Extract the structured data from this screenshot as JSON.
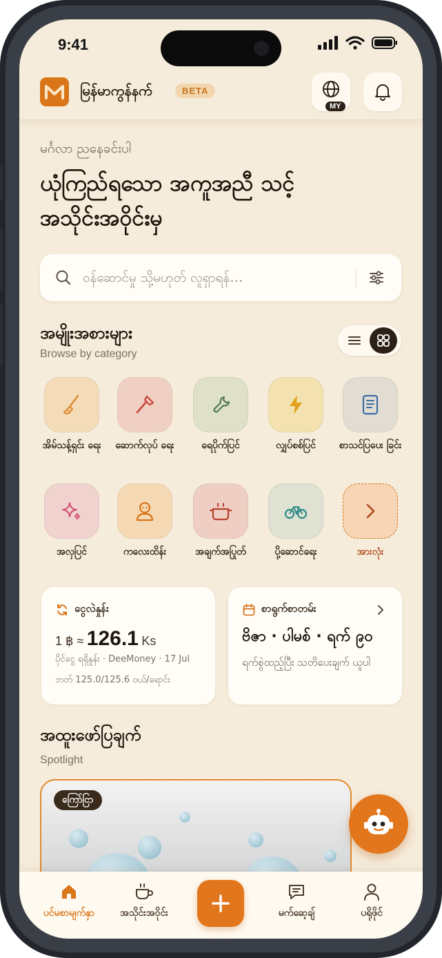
{
  "status_bar": {
    "time": "9:41"
  },
  "header": {
    "app_name": "မြန်မာကွန်နက်",
    "beta_badge": "BETA",
    "language_code": "MY",
    "icons": {
      "logo": "app-logo-m",
      "language": "globe-icon",
      "notifications": "bell-icon"
    }
  },
  "hero": {
    "greeting": "မင်္ဂလာ ညနေခင်းပါ",
    "title": "ယုံကြည်ရသော အကူအညီ သင့် အသိုင်းအဝိုင်းမှ"
  },
  "search": {
    "placeholder": "ဝန်ဆောင်မှု သို့မဟုတ် လူရှာရန်…"
  },
  "categories": {
    "title": "အမျိုးအစားများ",
    "subtitle": "Browse by category",
    "items": [
      {
        "label": "အိမ်သန့်ရှင်း ရေး",
        "icon": "broom-icon",
        "color": "#f4dcb9"
      },
      {
        "label": "ဆောက်လုပ် ရေး",
        "icon": "hammer-icon",
        "color": "#f0d0c2"
      },
      {
        "label": "ရေပိုက်ပြင်",
        "icon": "wrench-icon",
        "color": "#dfe0c8"
      },
      {
        "label": "လျှပ်စစ်ပြင်",
        "icon": "lightning-icon",
        "color": "#f3e2b0"
      },
      {
        "label": "စာသင်ပြပေး ခြင်း",
        "icon": "book-icon",
        "color": "#e2ddd3"
      },
      {
        "label": "အလှပြင်",
        "icon": "sparkle-icon",
        "color": "#f0d3cf"
      },
      {
        "label": "ကလေးထိန်း",
        "icon": "child-icon",
        "color": "#f4d9b4"
      },
      {
        "label": "အချက်အပြုတ်",
        "icon": "cooking-pot-icon",
        "color": "#efcfc4"
      },
      {
        "label": "ပို့ဆောင်ရေး",
        "icon": "bicycle-icon",
        "color": "#dfe1d3"
      },
      {
        "label": "အားလုံး",
        "icon": "chevron-right-icon",
        "color": "#f6d6b4"
      }
    ]
  },
  "exchange": {
    "title": "ငွေလဲနှုန်း",
    "prefix": "1 ฿ ≈",
    "rate": "126.1",
    "unit": "Ks",
    "source": "ပိုင်ငွေ ရရှိနှုန်း · DeeMoney · 17 Jul",
    "buy_sell": "ဘတ် 125.0/125.6 ဝယ်/ရောင်း"
  },
  "calendar": {
    "title": "စာရွက်စာတမ်း",
    "date": "ဗိဇာ · ပါမစ် · ရက် ၉၀",
    "note": "ရက်စွဲထည့်ပြီး သတိပေးချက် ယူပါ"
  },
  "spotlight": {
    "title": "အထူးဖော်ပြချက်",
    "subtitle": "Spotlight",
    "tag": "ကြော်ငြာ"
  },
  "assistant": {
    "icon": "robot-icon"
  },
  "bottom_nav": [
    {
      "label": "ပင်မစာမျက်နှာ",
      "icon": "home-icon",
      "active": true
    },
    {
      "label": "အသိုင်းအဝိုင်း",
      "icon": "coffee-cup-icon",
      "active": false
    },
    {
      "label": "",
      "icon": "plus-icon",
      "active": false
    },
    {
      "label": "မက်ဆေ့ချ်",
      "icon": "message-icon",
      "active": false
    },
    {
      "label": "ပရိုဖိုင်",
      "icon": "user-icon",
      "active": false
    }
  ],
  "colors": {
    "accent": "#d9761a",
    "background": "#f6ecdb",
    "dark": "#2c2118"
  }
}
